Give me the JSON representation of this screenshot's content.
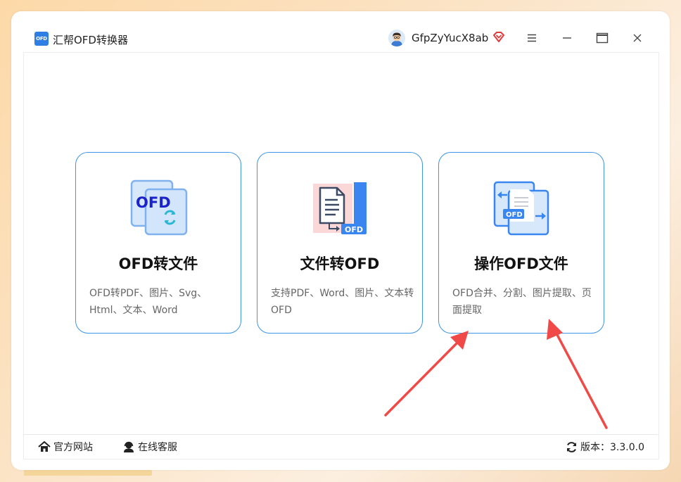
{
  "app": {
    "logo_text": "OFD",
    "title": "汇帮OFD转换器"
  },
  "user": {
    "name": "GfpZyYucX8ab"
  },
  "cards": [
    {
      "title": "OFD转文件",
      "desc": "OFD转PDF、图片、Svg、Html、文本、Word",
      "icon_text": "OFD"
    },
    {
      "title": "文件转OFD",
      "desc": "支持PDF、Word、图片、文本转OFD",
      "icon_text": "OFD"
    },
    {
      "title": "操作OFD文件",
      "desc": "OFD合并、分割、图片提取、页面提取",
      "icon_text": "OFD"
    }
  ],
  "footer": {
    "website": "官方网站",
    "support": "在线客服",
    "version_label": "版本：3.3.0.0"
  },
  "colors": {
    "accent": "#3d95e6",
    "brand_blue": "#2f7ee3",
    "annotation_red": "#f04a48"
  }
}
